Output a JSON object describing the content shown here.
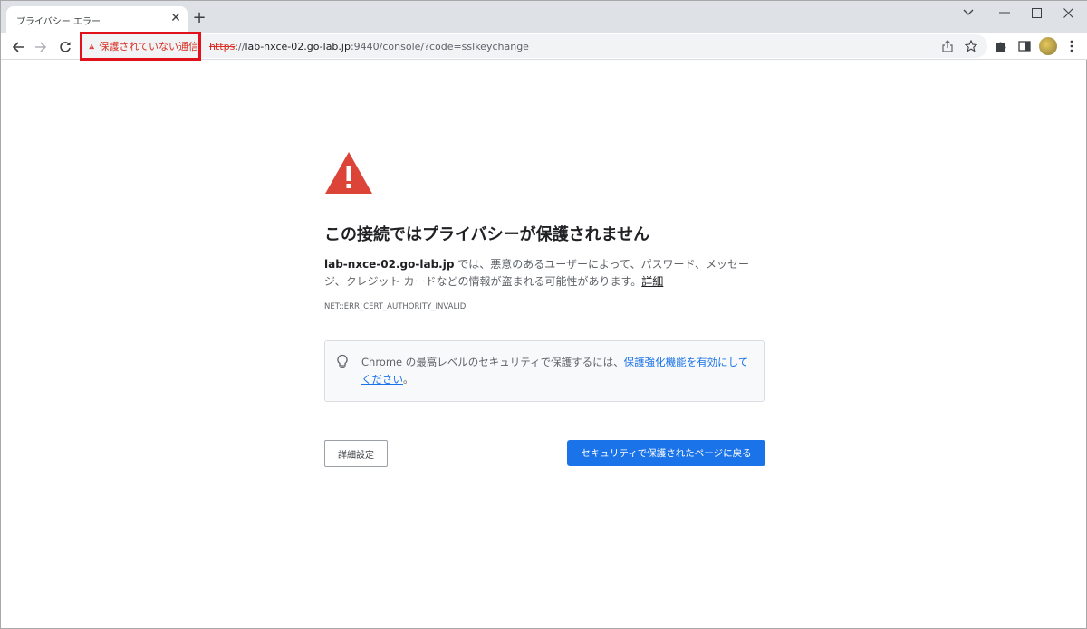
{
  "tab": {
    "title": "プライバシー エラー",
    "close_glyph": "✕",
    "new_tab_glyph": "+"
  },
  "toolbar": {
    "security_label": "保護されていない通信",
    "url_scheme": "https",
    "url_separator": "://",
    "url_host": "lab-nxce-02.go-lab.jp",
    "url_rest": ":9440/console/?code=sslkeychange"
  },
  "content": {
    "heading": "この接続ではプライバシーが保護されません",
    "desc_host": "lab-nxce-02.go-lab.jp",
    "desc_text": " では、悪意のあるユーザーによって、パスワード、メッセージ、クレジット カードなどの情報が盗まれる可能性があります。",
    "desc_detail_link": "詳細",
    "error_code": "NET::ERR_CERT_AUTHORITY_INVALID",
    "tip_prefix": "Chrome の最高レベルのセキュリティで保護するには、",
    "tip_link": "保護強化機能を有効にしてください",
    "tip_suffix": "。",
    "advanced_button": "詳細設定",
    "back_button": "セキュリティで保護されたページに戻る"
  },
  "colors": {
    "warning_red": "#d93025",
    "highlight_red": "#e0111b",
    "accent_blue": "#1a73e8"
  }
}
